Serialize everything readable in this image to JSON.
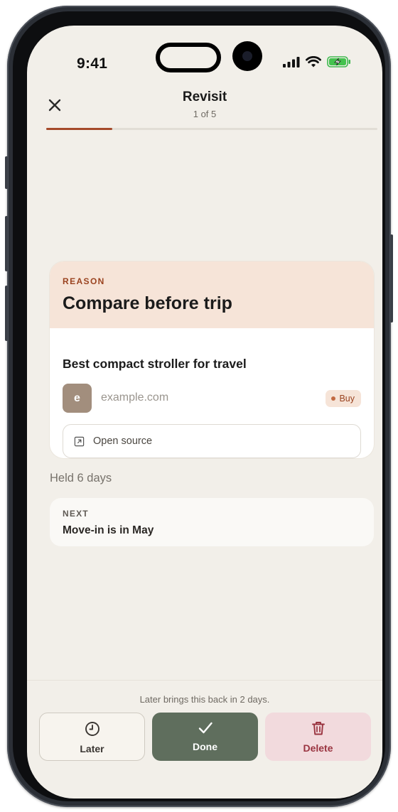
{
  "status_bar": {
    "time": "9:41",
    "icons": [
      "signal-icon",
      "wifi-icon",
      "battery-charging-icon"
    ]
  },
  "header": {
    "close_icon": "close-icon",
    "title": "Revisit",
    "subtitle": "1 of 5",
    "progress": 0.2
  },
  "reason_card": {
    "label": "REASON",
    "title": "Compare before trip",
    "item_title": "Best compact stroller for travel",
    "avatar_letter": "e",
    "domain": "example.com",
    "badge": "Buy",
    "open_source_label": "Open source",
    "open_source_icon": "external-link-icon"
  },
  "held_text": "Held 6 days",
  "next_card": {
    "label": "NEXT",
    "text": "Move-in is in May"
  },
  "footer": {
    "hint": "Later brings this back in 2 days.",
    "buttons": {
      "later": {
        "label": "Later",
        "icon": "clock-icon"
      },
      "done": {
        "label": "Done",
        "icon": "checkmark-icon"
      },
      "delete": {
        "label": "Delete",
        "icon": "trash-icon"
      }
    }
  },
  "colors": {
    "accent": "#a54a2a",
    "reason_bg": "#f6e4d8",
    "done_bg": "#5f6e5d",
    "delete_bg": "#f2dadd",
    "screen_bg": "#f2efe9"
  }
}
